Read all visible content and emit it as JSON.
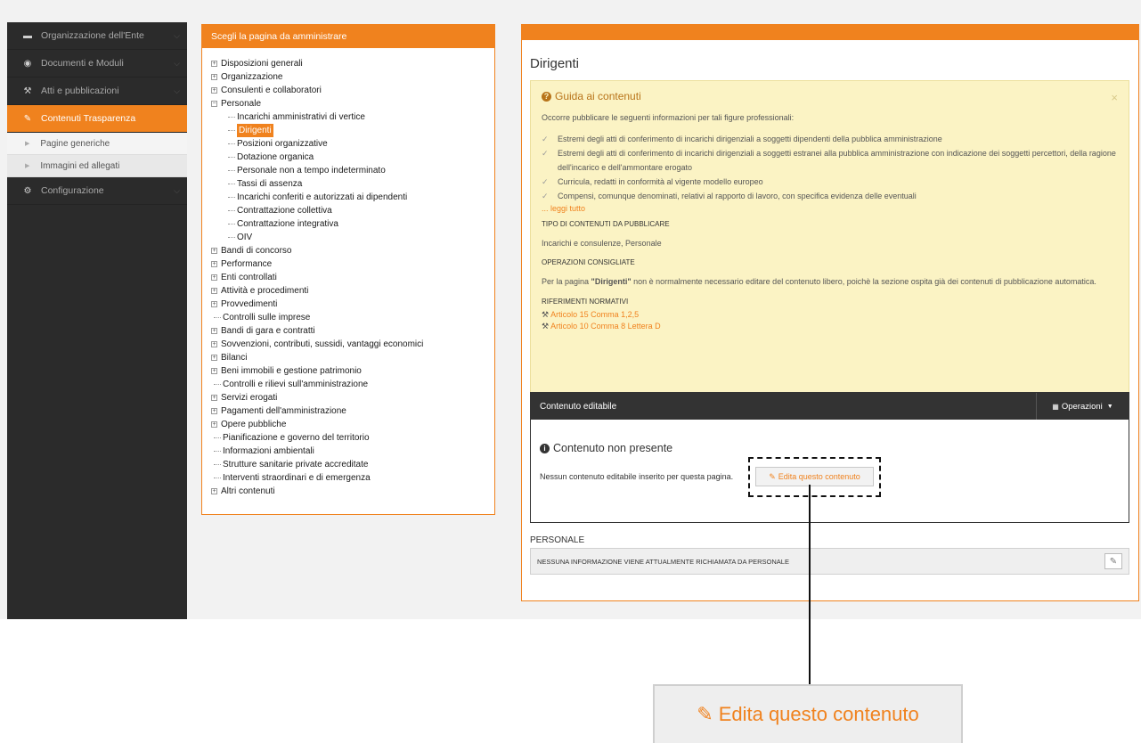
{
  "sidebar": {
    "items": [
      {
        "icon": "briefcase-icon",
        "glyph": "▬",
        "label": "Organizzazione dell'Ente",
        "active": false
      },
      {
        "icon": "document-icon",
        "glyph": "◉",
        "label": "Documenti e Moduli",
        "active": false
      },
      {
        "icon": "gavel-icon",
        "glyph": "⚒",
        "label": "Atti e pubblicazioni",
        "active": false
      },
      {
        "icon": "edit-icon",
        "glyph": "✎",
        "label": "Contenuti Trasparenza",
        "active": true
      }
    ],
    "subitems": [
      {
        "label": "Pagine generiche"
      },
      {
        "label": "Immagini ed allegati"
      }
    ],
    "config": {
      "icon": "cogs-icon",
      "glyph": "⚙",
      "label": "Configurazione"
    }
  },
  "tree": {
    "header": "Scegli la pagina da amministrare",
    "items": [
      {
        "label": "Disposizioni generali",
        "type": "parent",
        "sign": "+"
      },
      {
        "label": "Organizzazione",
        "type": "parent",
        "sign": "+"
      },
      {
        "label": "Consulenti e collaboratori",
        "type": "parent",
        "sign": "+"
      },
      {
        "label": "Personale",
        "type": "parent",
        "sign": "−"
      },
      {
        "label": "Incarichi amministrativi di vertice",
        "type": "child"
      },
      {
        "label": "Dirigenti",
        "type": "child",
        "selected": true
      },
      {
        "label": "Posizioni organizzative",
        "type": "child"
      },
      {
        "label": "Dotazione organica",
        "type": "child"
      },
      {
        "label": "Personale non a tempo indeterminato",
        "type": "child"
      },
      {
        "label": "Tassi di assenza",
        "type": "child"
      },
      {
        "label": "Incarichi conferiti e autorizzati ai dipendenti",
        "type": "child"
      },
      {
        "label": "Contrattazione collettiva",
        "type": "child"
      },
      {
        "label": "Contrattazione integrativa",
        "type": "child"
      },
      {
        "label": "OIV",
        "type": "child"
      },
      {
        "label": "Bandi di concorso",
        "type": "parent",
        "sign": "+"
      },
      {
        "label": "Performance",
        "type": "parent",
        "sign": "+"
      },
      {
        "label": "Enti controllati",
        "type": "parent",
        "sign": "+"
      },
      {
        "label": "Attività e procedimenti",
        "type": "parent",
        "sign": "+"
      },
      {
        "label": "Provvedimenti",
        "type": "parent",
        "sign": "+"
      },
      {
        "label": "Controlli sulle imprese",
        "type": "leaf"
      },
      {
        "label": "Bandi di gara e contratti",
        "type": "parent",
        "sign": "+"
      },
      {
        "label": "Sovvenzioni, contributi, sussidi, vantaggi economici",
        "type": "parent",
        "sign": "+"
      },
      {
        "label": "Bilanci",
        "type": "parent",
        "sign": "+"
      },
      {
        "label": "Beni immobili e gestione patrimonio",
        "type": "parent",
        "sign": "+"
      },
      {
        "label": "Controlli e rilievi sull'amministrazione",
        "type": "leaf"
      },
      {
        "label": "Servizi erogati",
        "type": "parent",
        "sign": "+"
      },
      {
        "label": "Pagamenti dell'amministrazione",
        "type": "parent",
        "sign": "+"
      },
      {
        "label": "Opere pubbliche",
        "type": "parent",
        "sign": "+"
      },
      {
        "label": "Pianificazione e governo del territorio",
        "type": "leaf"
      },
      {
        "label": "Informazioni ambientali",
        "type": "leaf"
      },
      {
        "label": "Strutture sanitarie private accreditate",
        "type": "leaf"
      },
      {
        "label": "Interventi straordinari e di emergenza",
        "type": "leaf"
      },
      {
        "label": "Altri contenuti",
        "type": "parent",
        "sign": "+"
      }
    ]
  },
  "content": {
    "title": "Dirigenti",
    "guide": {
      "title": "Guida ai contenuti",
      "close": "×",
      "intro": "Occorre pubblicare le seguenti informazioni per tali figure professionali:",
      "checks": [
        "Estremi degli atti di conferimento di incarichi dirigenziali a soggetti dipendenti della pubblica amministrazione",
        "Estremi degli atti di conferimento di incarichi dirigenziali a soggetti estranei alla pubblica amministrazione con indicazione dei soggetti percettori, della ragione dell'incarico e dell'ammontare erogato",
        "Curricula, redatti in conformità al vigente modello europeo",
        "Compensi, comunque denominati, relativi al rapporto di lavoro, con specifica evidenza delle eventuali"
      ],
      "read_more": "... leggi tutto",
      "tipo_label": "TIPO DI CONTENUTI DA PUBBLICARE",
      "tipo_value": "Incarichi e consulenze, Personale",
      "operazioni_label": "OPERAZIONI CONSIGLIATE",
      "operazioni_prefix": "Per la pagina ",
      "operazioni_page": "\"Dirigenti\"",
      "operazioni_suffix": " non è normalmente necessario editare del contenuto libero, poichè la sezione ospita già dei contenuti di pubblicazione automatica.",
      "riferimenti_label": "RIFERIMENTI NORMATIVI",
      "riferimenti": [
        "Articolo 15 Comma 1,2,5",
        "Articolo 10 Comma 8 Lettera D"
      ]
    },
    "editable": {
      "header": "Contenuto editabile",
      "operations": "Operazioni",
      "no_content_title": "Contenuto non presente",
      "no_content_text": "Nessun contenuto editabile inserito per questa pagina.",
      "edit_button": "Edita questo contenuto"
    },
    "personale": {
      "title": "PERSONALE",
      "message": "NESSUNA INFORMAZIONE VIENE ATTUALMENTE RICHIAMATA DA PERSONALE"
    }
  },
  "callout": {
    "label": "Edita questo contenuto"
  },
  "colors": {
    "accent": "#f0821e",
    "sidebar": "#2b2b2b",
    "guide_bg": "#fbf3c4"
  }
}
